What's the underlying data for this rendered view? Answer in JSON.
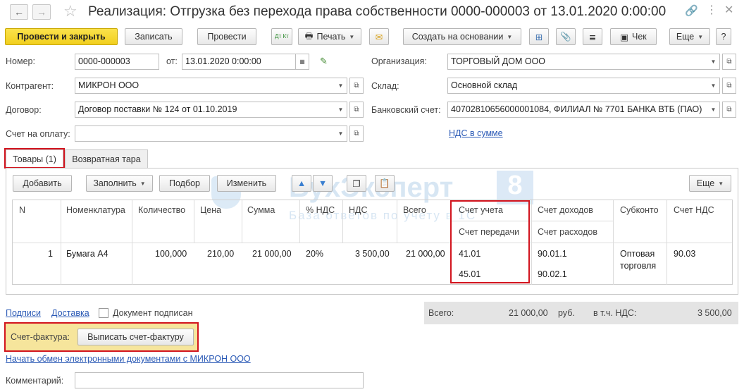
{
  "title": "Реализация: Отгрузка без перехода права собственности 0000-000003 от 13.01.2020 0:00:00",
  "toolbar": {
    "post_close": "Провести и закрыть",
    "save": "Записать",
    "post": "Провести",
    "dt_kt": "Дт Кт",
    "print": "Печать",
    "create_based": "Создать на основании",
    "receipt": "Чек",
    "more": "Еще",
    "help": "?"
  },
  "form": {
    "number_label": "Номер:",
    "number_value": "0000-000003",
    "date_label": "от:",
    "date_value": "13.01.2020  0:00:00",
    "org_label": "Организация:",
    "org_value": "ТОРГОВЫЙ ДОМ ООО",
    "contractor_label": "Контрагент:",
    "contractor_value": "МИКРОН ООО",
    "warehouse_label": "Склад:",
    "warehouse_value": "Основной склад",
    "contract_label": "Договор:",
    "contract_value": "Договор поставки № 124 от 01.10.2019",
    "bank_label": "Банковский счет:",
    "bank_value": "40702810656000001084, ФИЛИАЛ № 7701 БАНКА ВТБ (ПАО)",
    "invoice_label": "Счет на оплату:",
    "invoice_value": "",
    "vat_link": "НДС в сумме"
  },
  "tabs": [
    "Товары (1)",
    "Возвратная тара"
  ],
  "table_toolbar": {
    "add": "Добавить",
    "fill": "Заполнить",
    "pick": "Подбор",
    "change": "Изменить",
    "more": "Еще"
  },
  "table": {
    "headers": {
      "n": "N",
      "item": "Номенклатура",
      "qty": "Количество",
      "price": "Цена",
      "sum": "Сумма",
      "vat_pct": "% НДС",
      "vat": "НДС",
      "total": "Всего",
      "acc": "Счет учета",
      "acc_transfer": "Счет передачи",
      "income": "Счет доходов",
      "expense": "Счет расходов",
      "subconto": "Субконто",
      "vat_acc": "Счет НДС"
    },
    "row": {
      "n": "1",
      "item": "Бумага А4",
      "qty": "100,000",
      "price": "210,00",
      "sum": "21 000,00",
      "vat_pct": "20%",
      "vat": "3 500,00",
      "total": "21 000,00",
      "acc": "41.01",
      "acc_transfer": "45.01",
      "income": "90.01.1",
      "expense": "90.02.1",
      "subconto1": "Оптовая",
      "subconto2": "торговля",
      "vat_acc": "90.03"
    }
  },
  "watermark": {
    "brand": "БухЭксперт",
    "num": "8",
    "sub": "База ответов по учету в 1С"
  },
  "footer": {
    "signatures": "Подписи",
    "delivery": "Доставка",
    "signed": "Документ подписан",
    "total_label": "Всего:",
    "total_value": "21 000,00",
    "currency": "руб.",
    "vat_incl_label": "в т.ч. НДС:",
    "vat_incl_value": "3 500,00",
    "invoice_label": "Счет-фактура:",
    "invoice_button": "Выписать счет-фактуру",
    "edo_link": "Начать обмен электронными документами с МИКРОН ООО",
    "comment_label": "Комментарий:",
    "comment_value": ""
  },
  "colors": {
    "accent_yellow": "#f5d630",
    "highlight_red": "#d2141e",
    "link_blue": "#2b5ab6"
  }
}
